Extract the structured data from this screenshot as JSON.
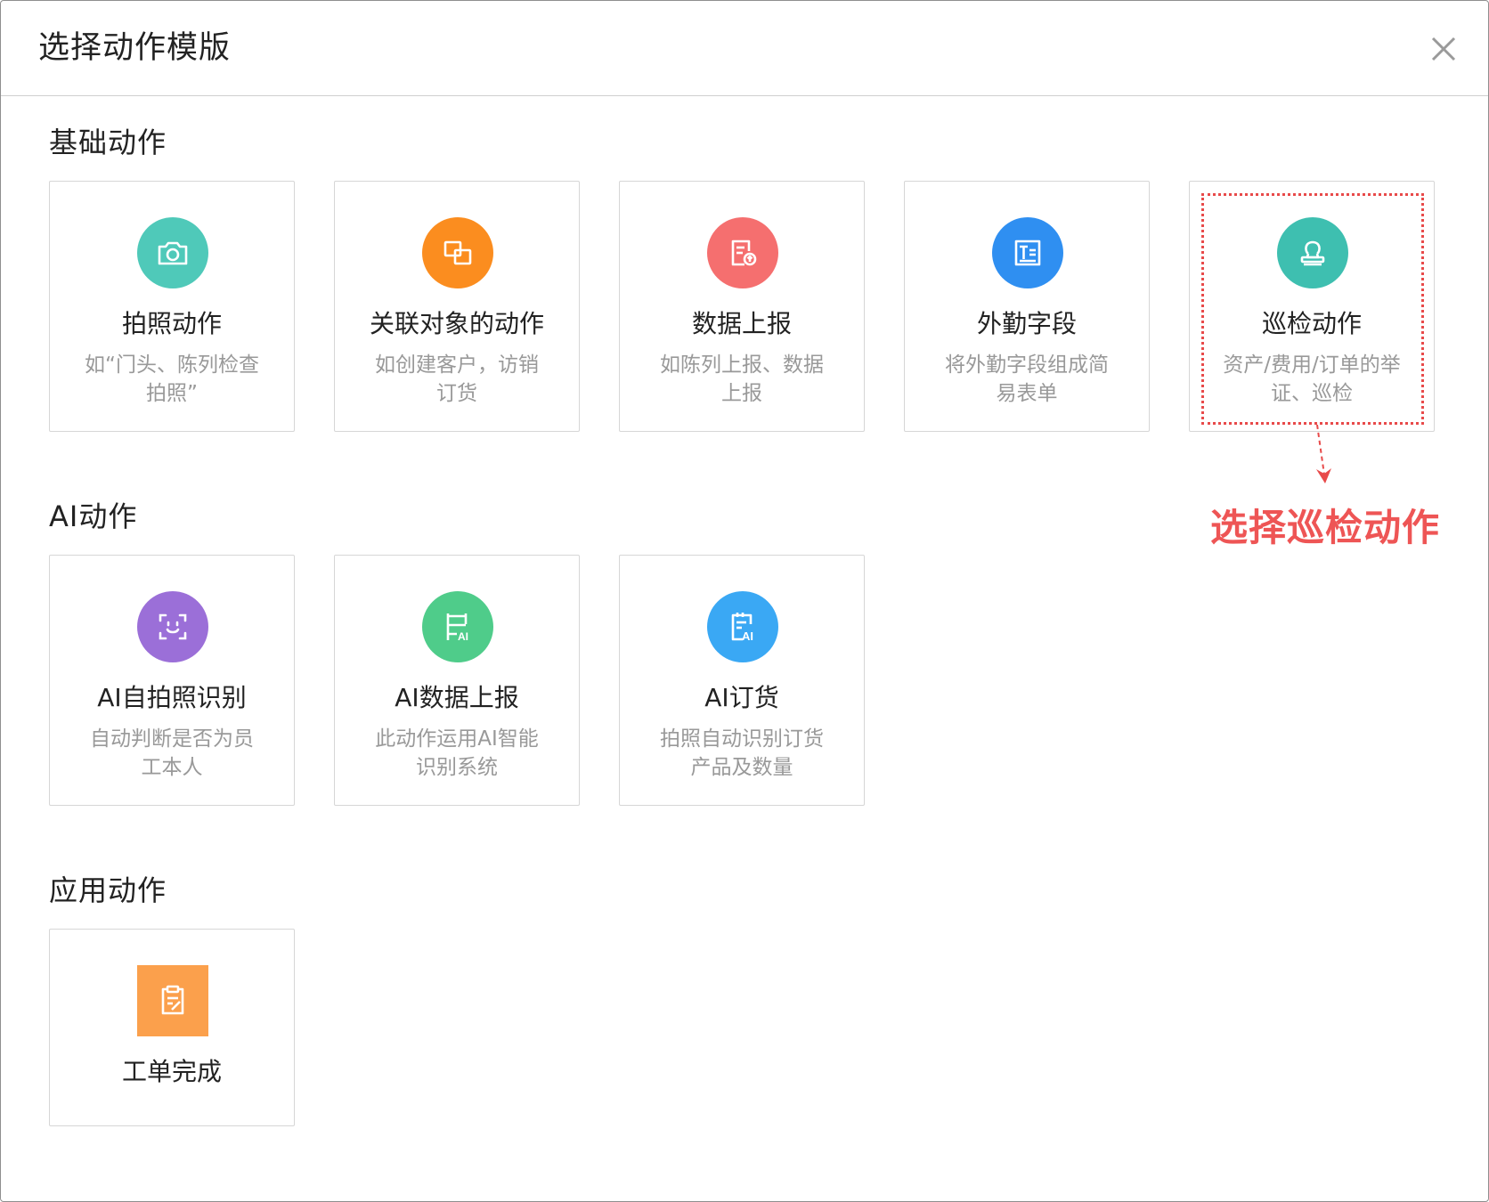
{
  "dialog": {
    "title": "选择动作模版",
    "close_icon": "close-icon"
  },
  "sections": {
    "basic": {
      "title": "基础动作",
      "cards": [
        {
          "name": "拍照动作",
          "desc": "如“门头、陈列检查拍照”",
          "icon": "camera-icon",
          "color": "#4fc9b9"
        },
        {
          "name": "关联对象的动作",
          "desc": "如创建客户，访销订货",
          "icon": "linked-objects-icon",
          "color": "#fb8d1f"
        },
        {
          "name": "数据上报",
          "desc": "如陈列上报、数据上报",
          "icon": "upload-report-icon",
          "color": "#f56f6f"
        },
        {
          "name": "外勤字段",
          "desc": "将外勤字段组成简易表单",
          "icon": "text-form-icon",
          "color": "#2f8ff1"
        },
        {
          "name": "巡检动作",
          "desc": "资产/费用/订单的举证、巡检",
          "icon": "stamp-icon",
          "color": "#3ebfb0"
        }
      ]
    },
    "ai": {
      "title": "AI动作",
      "cards": [
        {
          "name": "AI自拍照识别",
          "desc": "自动判断是否为员工本人",
          "icon": "face-scan-icon",
          "color": "#9b6fd8"
        },
        {
          "name": "AI数据上报",
          "desc": "此动作运用AI智能识别系统",
          "icon": "ai-shelf-icon",
          "color": "#4fcc8a"
        },
        {
          "name": "AI订货",
          "desc": "拍照自动识别订货产品及数量",
          "icon": "ai-notepad-icon",
          "color": "#3aa8f4"
        }
      ]
    },
    "app": {
      "title": "应用动作",
      "cards": [
        {
          "name": "工单完成",
          "icon": "clipboard-edit-icon",
          "color": "#fba04c"
        }
      ]
    }
  },
  "annotation": {
    "text": "选择巡检动作",
    "color": "#ee5555"
  }
}
